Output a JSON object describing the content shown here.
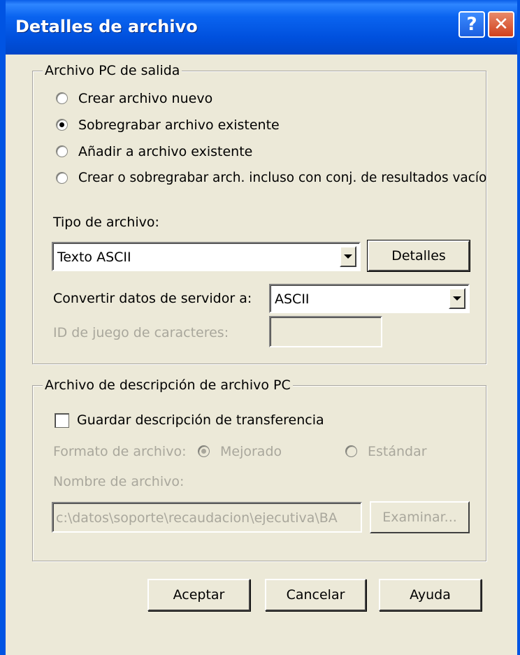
{
  "window": {
    "title": "Detalles de archivo"
  },
  "output_group": {
    "legend": "Archivo PC de salida",
    "options": [
      {
        "label": "Crear archivo nuevo",
        "selected": false
      },
      {
        "label": "Sobregrabar archivo existente",
        "selected": true
      },
      {
        "label": "Añadir a archivo existente",
        "selected": false
      },
      {
        "label": "Crear o sobregrabar arch. incluso con conj. de resultados vacío",
        "selected": false
      }
    ],
    "file_type_label": "Tipo de archivo:",
    "file_type_value": "Texto ASCII",
    "details_button": "Detalles",
    "convert_label": "Convertir datos de servidor a:",
    "convert_value": "ASCII",
    "charset_label": "ID de juego de caracteres:",
    "charset_value": ""
  },
  "desc_group": {
    "legend": "Archivo de descripción de archivo PC",
    "save_checkbox_label": "Guardar descripción de transferencia",
    "save_checked": false,
    "format_label": "Formato de archivo:",
    "format_options": [
      {
        "label": "Mejorado",
        "selected": true
      },
      {
        "label": "Estándar",
        "selected": false
      }
    ],
    "file_name_label": "Nombre de archivo:",
    "file_name_value": "c:\\datos\\soporte\\recaudacion\\ejecutiva\\BA",
    "browse_button": "Examinar..."
  },
  "footer": {
    "ok": "Aceptar",
    "cancel": "Cancelar",
    "help": "Ayuda"
  },
  "icons": {
    "help": "?",
    "close": "✕"
  }
}
